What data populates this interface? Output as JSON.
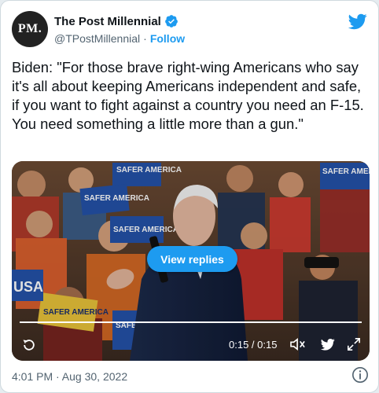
{
  "header": {
    "avatar_text": "PM.",
    "display_name": "The Post Millennial",
    "handle": "@TPostMillennial",
    "separator": "·",
    "follow_label": "Follow"
  },
  "tweet": {
    "text": "Biden: \"For those brave right-wing Americans who say it's all about keeping Americans independent and safe, if you want to fight against a country you need an F-15. You need something a little more than a gun.\""
  },
  "video": {
    "signs": [
      "SAFER AMERICA",
      "SAFER AMERICA",
      "SAFER AMERICA",
      "SAFER AMERICA",
      "SAFER AMERICA",
      "SAFER AMERICA",
      "USA"
    ],
    "view_replies_label": "View replies",
    "timecode": "0:15 / 0:15",
    "progress": 1.0
  },
  "footer": {
    "timestamp": "4:01 PM · Aug 30, 2022"
  },
  "icons": [
    "verified-badge-icon",
    "twitter-bird-icon",
    "replay-icon",
    "volume-icon",
    "twitter-small-icon",
    "expand-icon",
    "info-icon"
  ],
  "colors": {
    "accent": "#1d9bf0",
    "text": "#0f1419",
    "muted": "#536471"
  }
}
